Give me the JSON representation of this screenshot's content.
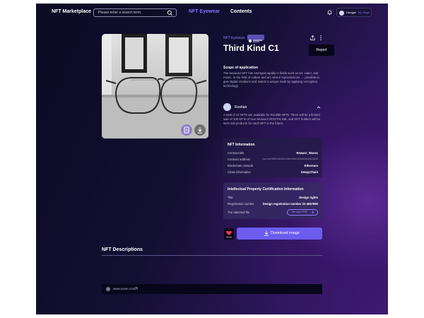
{
  "header": {
    "brand": "NFT Marketplace",
    "search_placeholder": "Please enter a search term",
    "nav": [
      "NFT Eyewear",
      "Contents"
    ],
    "user_name": "Hongjal",
    "user_link": "My Page"
  },
  "item": {
    "category": "NFT Eyewear",
    "title": "Third Kind C1",
    "report_label": "Report",
    "scope_heading": "Scope of application",
    "scope_text": "The keyword NFT has emerged rapidly in fields such as art, video, and music. In the field of culture and art, where reproductions, ... possible to give digital creations and assets a unique mark by applying encryption technology.",
    "creator_name": "Rootlab",
    "creator_text": "A total of 12 NFTs are available for Rootlab NFTs. There will be a limited sale of 100 NFTs of Gun Museum ROOTALINE, and NFT holders will be sent real products for each NFT in the future.",
    "download_label": "Download image"
  },
  "nft_info": {
    "heading": "NFT Information",
    "rows": [
      {
        "k": "Contract title",
        "v": "Rewarn_Wave1"
      },
      {
        "k": "Contract address",
        "v": "0xac4ba3f6f5f3c6fd3b7c95eb9fb3c3e5a5d4feb3d28ed6"
      },
      {
        "k": "Blockchain network",
        "v": "Ethereum"
      },
      {
        "k": "Chain information",
        "v": "DeepyChain"
      }
    ]
  },
  "ip_info": {
    "heading": "Intellectual Property Certification Information",
    "rows": [
      {
        "k": "Title",
        "v": "Design rights"
      },
      {
        "k": "Registration number",
        "v": "Design registration number 22-4567890"
      },
      {
        "k": "The attached file",
        "v": "file name.PDF"
      }
    ]
  },
  "descriptions": {
    "heading": "NFT Descriptions",
    "url": "www.naver.com"
  }
}
